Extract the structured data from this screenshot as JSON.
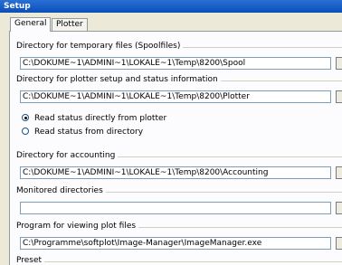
{
  "window": {
    "title": "Setup"
  },
  "tabs": [
    {
      "label": "General",
      "active": true
    },
    {
      "label": "Plotter",
      "active": false
    }
  ],
  "groups": {
    "spool": {
      "label": "Directory for temporary files (Spoolfiles)",
      "value": "C:\\DOKUME~1\\ADMINI~1\\LOKALE~1\\Temp\\8200\\Spool"
    },
    "plotter": {
      "label": "Directory for plotter setup and status information",
      "value": "C:\\DOKUME~1\\ADMINI~1\\LOKALE~1\\Temp\\8200\\Plotter"
    },
    "accounting": {
      "label": "Directory for accounting",
      "value": "C:\\DOKUME~1\\ADMINI~1\\LOKALE~1\\Temp\\8200\\Accounting"
    },
    "monitored": {
      "label": "Monitored directories",
      "value": ""
    },
    "viewer": {
      "label": "Program for viewing plot files",
      "value": "C:\\Programme\\softplot\\Image-Manager\\ImageManager.exe"
    },
    "preset": {
      "label": "Preset"
    }
  },
  "status_options": [
    {
      "label": "Read status directly from plotter",
      "selected": true
    },
    {
      "label": "Read status from directory",
      "selected": false
    }
  ]
}
